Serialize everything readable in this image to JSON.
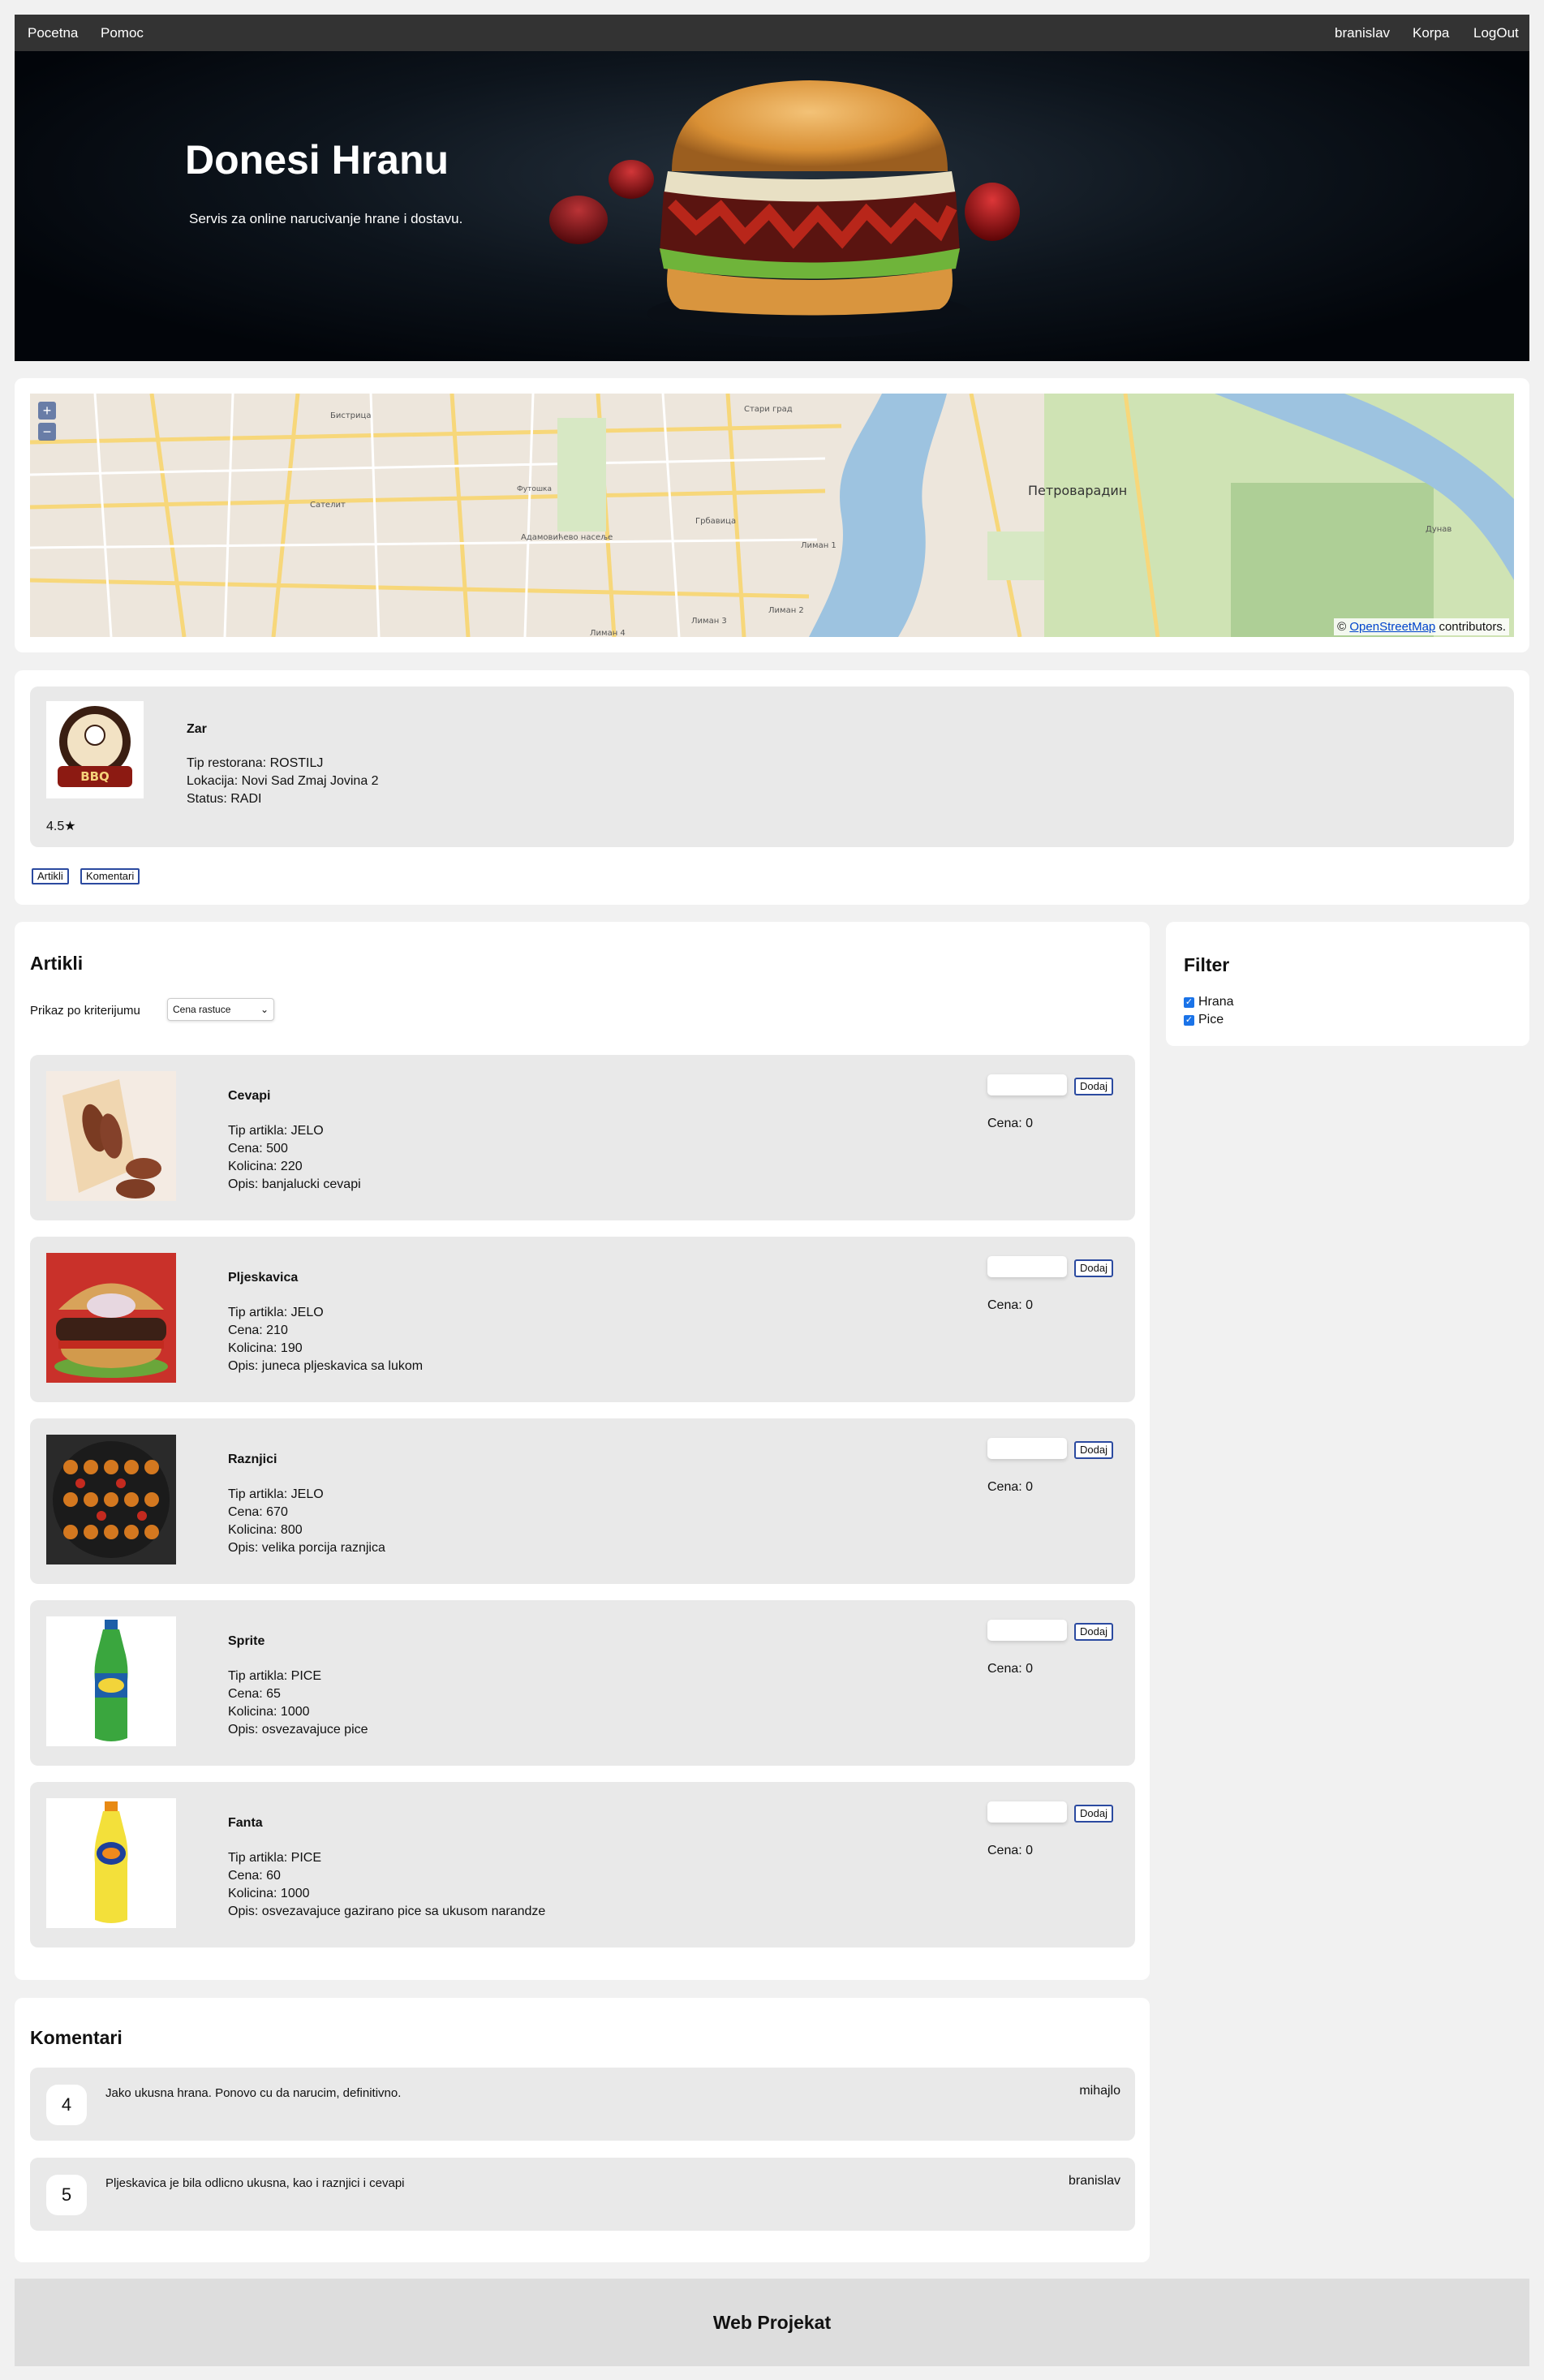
{
  "nav": {
    "left": [
      {
        "label": "Pocetna"
      },
      {
        "label": "Pomoc"
      }
    ],
    "right": [
      {
        "label": "branislav"
      },
      {
        "label": "Korpa"
      },
      {
        "label": "LogOut"
      }
    ]
  },
  "hero": {
    "title": "Donesi Hranu",
    "subtitle": "Servis za online narucivanje hrane i dostavu."
  },
  "map": {
    "zoom_in": "+",
    "zoom_out": "−",
    "attribution_prefix": "© ",
    "attribution_link": "OpenStreetMap",
    "attribution_suffix": " contributors.",
    "labels": [
      "Бистрица",
      "Сателит",
      "Грбавица",
      "Лиман 1",
      "Лиман 2",
      "Лиман 3",
      "Лиман 4",
      "Петроварадин",
      "Стари град",
      "Адамовићево насеље",
      "Футошка",
      "Дунав"
    ]
  },
  "restaurant": {
    "name": "Zar",
    "type_line": "Tip restorana: ROSTILJ",
    "location_line": "Lokacija: Novi Sad Zmaj Jovina 2",
    "status_line": "Status: RADI",
    "rating": "4.5★",
    "logo_text": "BAD TO THE BONE BBQ",
    "tabs": [
      {
        "label": "Artikli"
      },
      {
        "label": "Komentari"
      }
    ]
  },
  "artikli": {
    "title": "Artikli",
    "sort_label": "Prikaz po kriterijumu",
    "sort_selected": "Cena rastuce",
    "add_label": "Dodaj",
    "items": [
      {
        "name": "Cevapi",
        "type": "Tip artikla: JELO",
        "price": "Cena: 500",
        "qty": "Kolicina: 220",
        "desc": "Opis: banjalucki cevapi",
        "cart_price": "Cena: 0"
      },
      {
        "name": "Pljeskavica",
        "type": "Tip artikla: JELO",
        "price": "Cena: 210",
        "qty": "Kolicina: 190",
        "desc": "Opis: juneca pljeskavica sa lukom",
        "cart_price": "Cena: 0"
      },
      {
        "name": "Raznjici",
        "type": "Tip artikla: JELO",
        "price": "Cena: 670",
        "qty": "Kolicina: 800",
        "desc": "Opis: velika porcija raznjica",
        "cart_price": "Cena: 0"
      },
      {
        "name": "Sprite",
        "type": "Tip artikla: PICE",
        "price": "Cena: 65",
        "qty": "Kolicina: 1000",
        "desc": "Opis: osvezavajuce pice",
        "cart_price": "Cena: 0"
      },
      {
        "name": "Fanta",
        "type": "Tip artikla: PICE",
        "price": "Cena: 60",
        "qty": "Kolicina: 1000",
        "desc": "Opis: osvezavajuce gazirano pice sa ukusom narandze",
        "cart_price": "Cena: 0"
      }
    ]
  },
  "filter": {
    "title": "Filter",
    "options": [
      {
        "label": "Hrana",
        "checked": true
      },
      {
        "label": "Pice",
        "checked": true
      }
    ]
  },
  "komentari": {
    "title": "Komentari",
    "items": [
      {
        "rating": "4",
        "text": "Jako ukusna hrana. Ponovo cu da narucim, definitivno.",
        "user": "mihajlo"
      },
      {
        "rating": "5",
        "text": "Pljeskavica je bila odlicno ukusna, kao i raznjici i cevapi",
        "user": "branislav"
      }
    ]
  },
  "footer": {
    "text": "Web Projekat"
  },
  "colors": {
    "nav_bg": "#333333",
    "card_bg": "#ffffff",
    "item_bg": "#e9e9e9",
    "button_border": "#2b4aa0",
    "page_bg": "#f1f1f1",
    "footer_bg": "#dddddd"
  }
}
